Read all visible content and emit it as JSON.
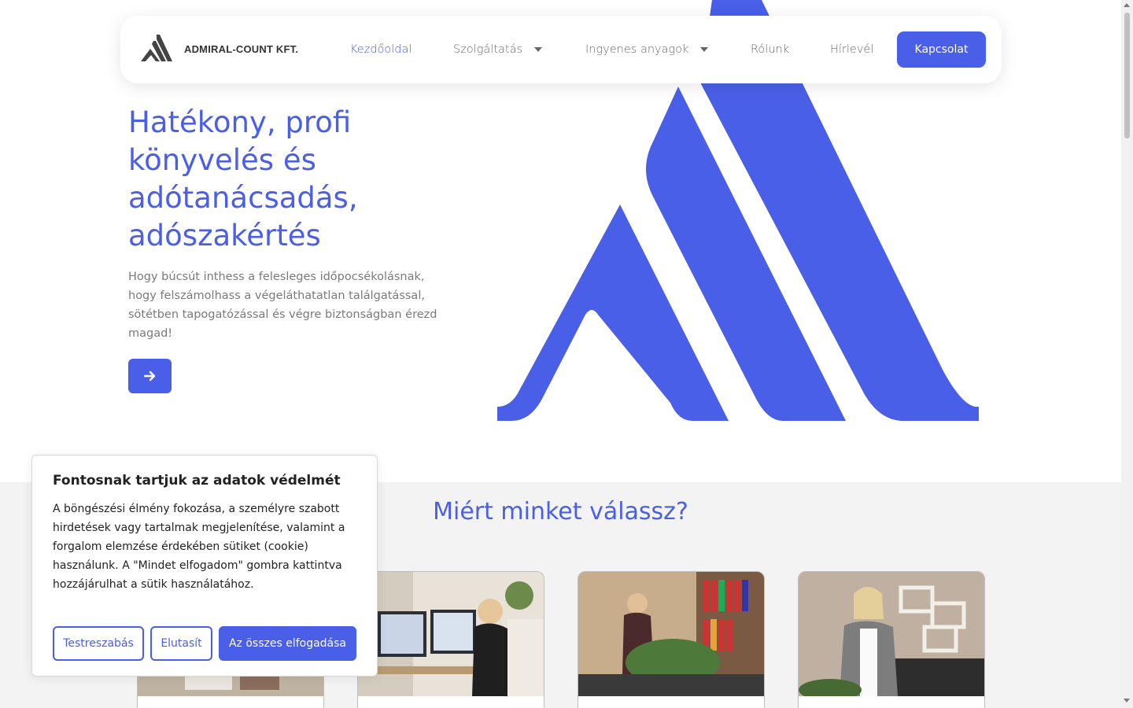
{
  "colors": {
    "accent": "#4a5fe8",
    "section_bg": "#f3f3f3",
    "text_muted": "#7a7a7a"
  },
  "header": {
    "brand": "ADMIRAL-COUNT KFT.",
    "nav": {
      "home": "Kezdőoldal",
      "services": "Szolgáltatás",
      "free_materials": "Ingyenes anyagok",
      "about": "Rólunk",
      "newsletter": "Hírlevél"
    },
    "contact_button": "Kapcsolat",
    "dropdown_icon": "caret-down-icon"
  },
  "hero": {
    "title": "Hatékony, profi könyvelés és adótanácsadás, adószakértés",
    "text": "Hogy búcsút inthess a felesleges időpocsékolásnak, hogy felszámolhass a végeláthatatlan találgatással, sötétben tapogatózással és végre biztonságban érezd magad!",
    "button_icon": "arrow-right-icon"
  },
  "why": {
    "title": "Miért minket válassz?"
  },
  "cookie": {
    "title": "Fontosnak tartjuk az adatok védelmét",
    "text": "A böngészési élmény fokozása, a személyre szabott hirdetések vagy tartalmak megjelenítése, valamint a forgalom elemzése érdekében sütiket (cookie) használunk. A \"Mindet elfogadom\" gombra kattintva hozzájárulhat a sütik használatához.",
    "buttons": {
      "customize": "Testreszabás",
      "reject": "Elutasít",
      "accept_all": "Az összes elfogadása"
    }
  }
}
